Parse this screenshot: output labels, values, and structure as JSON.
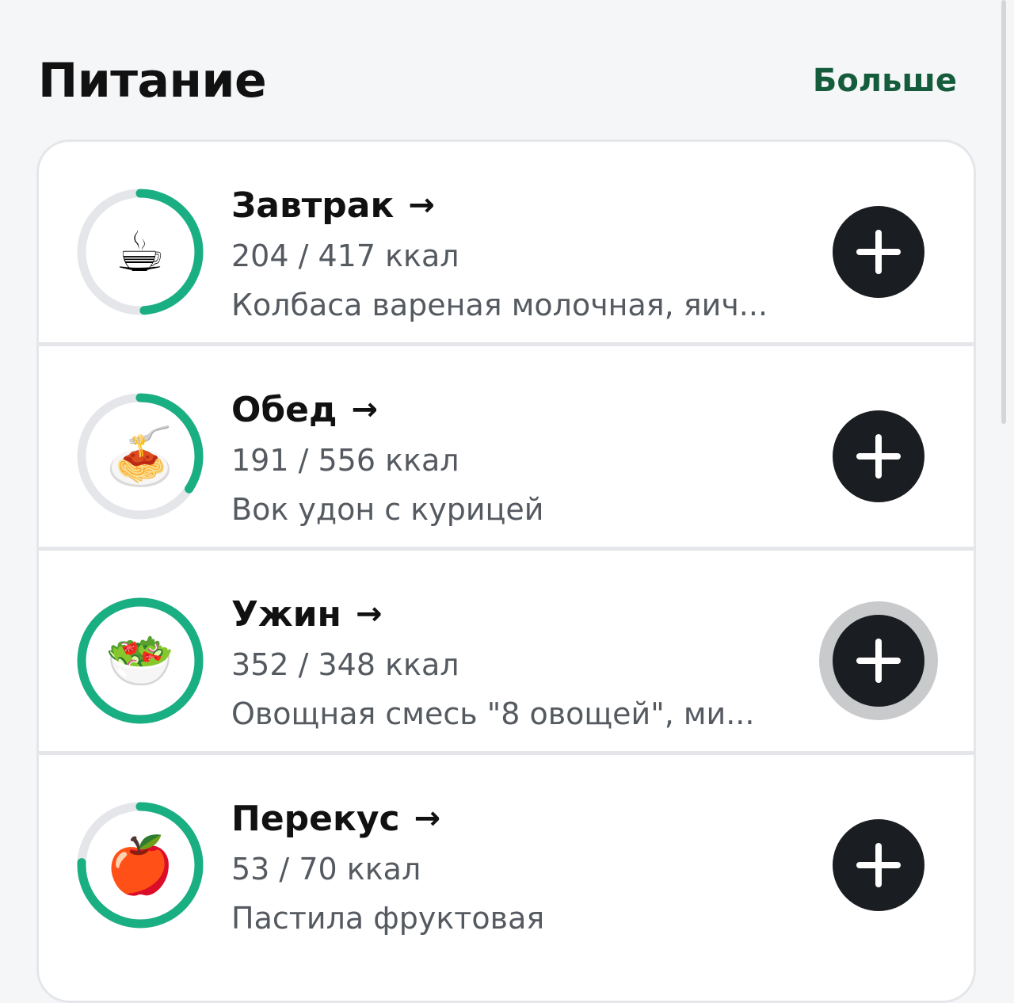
{
  "header": {
    "title": "Питание",
    "more_label": "Больше"
  },
  "colors": {
    "progress": "#1aae83",
    "track": "#e4e6e9",
    "add_button": "#1a1d21",
    "more_link": "#155c3d"
  },
  "meals": [
    {
      "name": "Завтрак",
      "arrow": "→",
      "icon": "coffee-cup-icon",
      "emoji": "☕",
      "consumed": 204,
      "target": 417,
      "kcal_label": "204 / 417 ккал",
      "foods": "Колбаса вареная молочная, яич..."
    },
    {
      "name": "Обед",
      "arrow": "→",
      "icon": "noodle-bowl-icon",
      "emoji": "🍝",
      "consumed": 191,
      "target": 556,
      "kcal_label": "191 / 556 ккал",
      "foods": "Вок удон с курицей"
    },
    {
      "name": "Ужин",
      "arrow": "→",
      "icon": "salad-bowl-icon",
      "emoji": "🥗",
      "consumed": 352,
      "target": 348,
      "kcal_label": "352 / 348 ккал",
      "foods": "Овощная смесь \"8 овощей\", ми..."
    },
    {
      "name": "Перекус",
      "arrow": "→",
      "icon": "apple-icon",
      "emoji": "🍎",
      "consumed": 53,
      "target": 70,
      "kcal_label": "53 / 70 ккал",
      "foods": "Пастила фруктовая"
    }
  ]
}
